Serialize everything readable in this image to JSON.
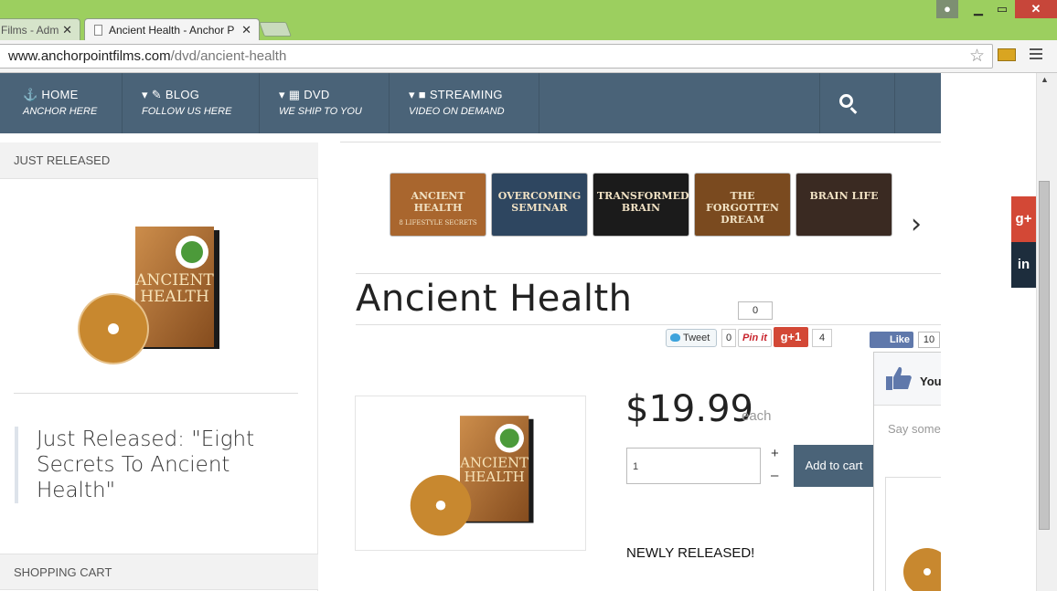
{
  "browser": {
    "tabs": [
      {
        "label": "Films - Adm"
      },
      {
        "label": "Ancient Health - Anchor P"
      }
    ],
    "url_host": "www.anchorpointfilms.com",
    "url_path": "/dvd/ancient-health"
  },
  "nav": {
    "items": [
      {
        "label": "HOME",
        "sub": "ANCHOR HERE",
        "icon": "anchor-icon"
      },
      {
        "label": "BLOG",
        "sub": "FOLLOW US HERE",
        "icon": "edit-icon"
      },
      {
        "label": "DVD",
        "sub": "WE SHIP TO YOU",
        "icon": "film-icon"
      },
      {
        "label": "STREAMING",
        "sub": "VIDEO ON DEMAND",
        "icon": "video-camera-icon"
      }
    ]
  },
  "sidebar": {
    "just_released_heading": "JUST RELEASED",
    "feature_text": "Just Released: \"Eight Secrets To Ancient Health\"",
    "cart_heading": "SHOPPING CART"
  },
  "thumbnails": [
    {
      "title": "ANCIENT HEALTH",
      "subtitle": "8 LIFESTYLE SECRETS",
      "bg": "#a9662e"
    },
    {
      "title": "OVERCOMING SEMINAR",
      "subtitle": "",
      "bg": "#2e4660"
    },
    {
      "title": "TRANSFORMED BRAIN",
      "subtitle": "",
      "bg": "#1b1b1b"
    },
    {
      "title": "THE FORGOTTEN DREAM",
      "subtitle": "",
      "bg": "#7a4a1f"
    },
    {
      "title": "BRAIN LIFE",
      "subtitle": "",
      "bg": "#3a2a22"
    }
  ],
  "product": {
    "title": "Ancient Health",
    "price": "$19.99",
    "unit": "each",
    "quantity": "1",
    "add_to_cart": "Add to cart",
    "status": "NEWLY RELEASED!",
    "dvd_title_line1": "ANCIENT",
    "dvd_title_line2": "HEALTH"
  },
  "social": {
    "tweet_label": "Tweet",
    "tweet_count": "0",
    "pin_label": "Pin it",
    "pin_count": "0",
    "gplus_label": "g+1",
    "gplus_count": "4",
    "like_label": "Like",
    "like_count": "10",
    "fb_you": "You",
    "fb_say": "Say some"
  },
  "qty_controls": {
    "plus": "+",
    "minus": "–"
  },
  "colors": {
    "nav": "#4a6378",
    "chrome": "#9ccf5f",
    "gplus": "#d34836",
    "linkedin": "#1d2d3d"
  }
}
